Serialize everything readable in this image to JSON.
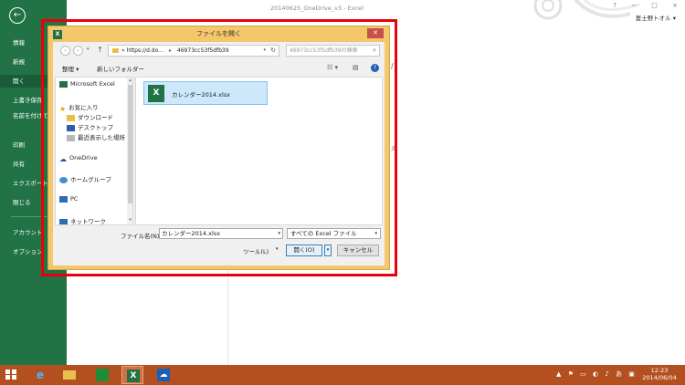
{
  "excel": {
    "title": "20140625_OneDrive_v3 - Excel",
    "window_controls": [
      "?",
      "−",
      "□",
      "×"
    ],
    "user": "富士野トオル ▾",
    "back_glyph": "←",
    "menu": [
      "情報",
      "新規",
      "開く",
      "上書き保存",
      "名前を付けて保存",
      "印刷",
      "共有",
      "エクスポート",
      "閉じる",
      "アカウント",
      "オプション"
    ],
    "active_menu": "開く",
    "background_text": [
      "/",
      "ル"
    ]
  },
  "dialog": {
    "title": "ファイルを開く",
    "close": "✕",
    "nav": {
      "back": "‹",
      "forward": "›",
      "dropdown": "▾",
      "up": "↑",
      "address_parts": [
        "« https://d.do...",
        "▸",
        "46973cc53f5dfb39"
      ],
      "address_dropdown": "▾",
      "refresh": "↻",
      "search_placeholder": "46973cc53f5dfb39の検索",
      "search_glyph": "⌕"
    },
    "toolbar": {
      "organize": "整理 ▾",
      "new_folder": "新しいフォルダー",
      "view_glyph": "☷ ▾",
      "pane_glyph": "▤",
      "help": "?"
    },
    "nav_pane": [
      "Microsoft Excel",
      "お気に入り",
      "ダウンロード",
      "デスクトップ",
      "最近表示した場所",
      "OneDrive",
      "ホームグループ",
      "PC",
      "ネットワーク"
    ],
    "scroll_up": "▴",
    "scroll_down": "▾",
    "file": {
      "name": "カレンダー2014.xlsx",
      "icon_letter": "X"
    },
    "filename_label": "ファイル名(N):",
    "filename_value": "カレンダー2014.xlsx",
    "filetype": "すべての Excel ファイル",
    "tools": "ツール(L)",
    "dropdown_glyph": "▾",
    "open": "開く(O)",
    "cancel": "キャンセル"
  },
  "taskbar": {
    "apps": [
      "IE",
      "Explorer",
      "Store",
      "Excel",
      "OneDrive"
    ],
    "tray_icons": [
      "▲",
      "⚑",
      "▭",
      "◐",
      "♪",
      "あ",
      "▣"
    ],
    "time": "12:23",
    "date": "2014/06/04"
  },
  "colors": {
    "excel_green": "#217346",
    "highlight_red": "#e8000b",
    "dialog_frame": "#f3c76a",
    "taskbar": "#b4501f"
  }
}
